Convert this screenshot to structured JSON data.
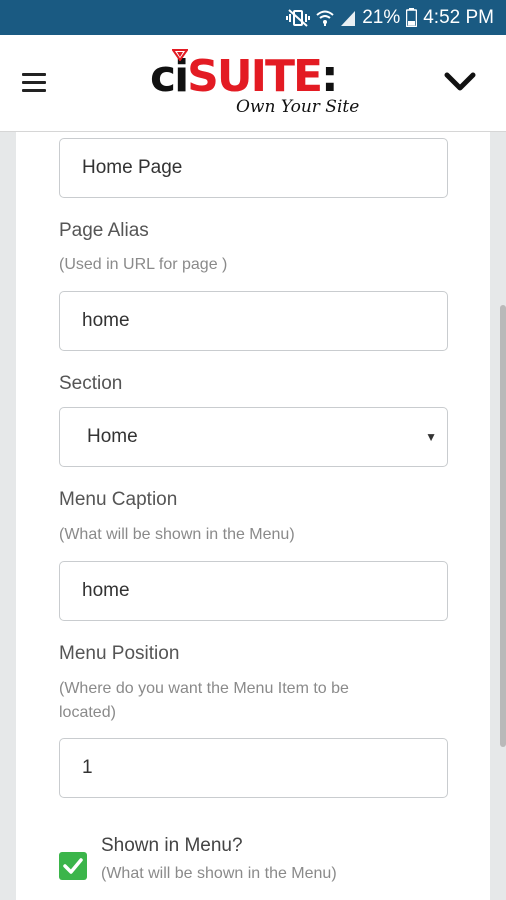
{
  "status_bar": {
    "battery": "21%",
    "time": "4:52 PM"
  },
  "header": {
    "logo_prefix": "ci",
    "logo_main": "SUITE",
    "logo_suffix": ":",
    "tagline": "Own Your Site"
  },
  "form": {
    "page_title_value": "Home Page",
    "page_alias_label": "Page Alias",
    "page_alias_help": "(Used in URL for page )",
    "page_alias_value": "home",
    "section_label": "Section",
    "section_value": "Home",
    "menu_caption_label": "Menu Caption",
    "menu_caption_help": "(What will be shown in the Menu)",
    "menu_caption_value": "home",
    "menu_position_label": "Menu Position",
    "menu_position_help": "(Where do you want the Menu Item to be located)",
    "menu_position_value": "1",
    "shown_in_menu_label": "Shown in Menu?",
    "shown_in_menu_help": "(What will be shown in the Menu)",
    "shown_in_menu_checked": true
  },
  "colors": {
    "status_bar": "#1a5a82",
    "brand_red": "#e31b23",
    "checkbox_green": "#3bb54a"
  }
}
